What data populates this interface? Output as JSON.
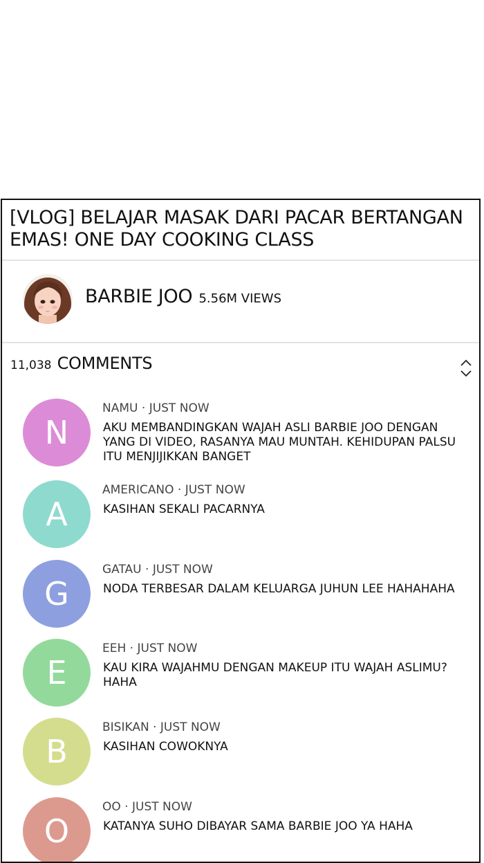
{
  "video": {
    "title": "[VLOG] BELAJAR MASAK DARI PACAR BERTANGAN EMAS! ONE DAY COOKING CLASS",
    "channel_name": "BARBIE JOO",
    "views": "5.56M VIEWS"
  },
  "comments_section": {
    "count": "11,038",
    "label": "COMMENTS",
    "sort_icon": "chevron-up-down-icon"
  },
  "comments": [
    {
      "initial": "N",
      "author": "NAMU",
      "separator": " · ",
      "time": "JUST NOW",
      "text": "AKU MEMBANDINGKAN WAJAH ASLI BARBIE JOO DENGAN YANG DI VIDEO, RASANYA MAU MUNTAH. KEHIDUPAN PALSU ITU MENJIJIKKAN BANGET",
      "color": "#dc8cd6"
    },
    {
      "initial": "A",
      "author": "AMERICANO",
      "separator": " · ",
      "time": "JUST NOW",
      "text": "KASIHAN SEKALI PACARNYA",
      "color": "#8fdace"
    },
    {
      "initial": "G",
      "author": "GATAU",
      "separator": " · ",
      "time": "JUST NOW",
      "text": "NODA TERBESAR DALAM KELUARGA JUHUN LEE HAHAHAHA",
      "color": "#8e9fdf"
    },
    {
      "initial": "E",
      "author": "EEH",
      "separator": " · ",
      "time": "JUST NOW",
      "text": "KAU KIRA WAJAHMU DENGAN MAKEUP ITU WAJAH ASLIMU? HAHA",
      "color": "#93d99b"
    },
    {
      "initial": "B",
      "author": "BISIKAN",
      "separator": " · ",
      "time": "JUST NOW",
      "text": "KASIHAN COWOKNYA",
      "color": "#d4dd8e"
    },
    {
      "initial": "O",
      "author": "OO",
      "separator": " · ",
      "time": "JUST NOW",
      "text": "KATANYA SUHO DIBAYAR SAMA BARBIE JOO YA HAHA",
      "color": "#dc9a8e"
    }
  ]
}
